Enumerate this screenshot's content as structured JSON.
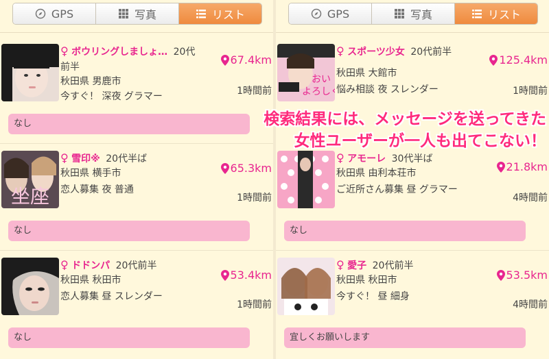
{
  "tabs": {
    "gps": "GPS",
    "photo": "写真",
    "list": "リスト"
  },
  "left": [
    {
      "name": "ボウリングしましょ…",
      "age": "20代",
      "age2": "前半",
      "pref": "秋田県",
      "city": "男鹿市",
      "tags": "今すぐ！ 深夜 グラマー",
      "distance": "67.4km",
      "time": "1時間前",
      "message": "なし"
    },
    {
      "name": "雪印※",
      "age": "20代半ば",
      "pref": "秋田県",
      "city": "横手市",
      "tags": "恋人募集 夜 普通",
      "distance": "65.3km",
      "time": "1時間前",
      "message": "なし"
    },
    {
      "name": "ドドンパ",
      "age": "20代前半",
      "pref": "秋田県",
      "city": "秋田市",
      "tags": "恋人募集 昼 スレンダー",
      "distance": "53.4km",
      "time": "1時間前",
      "message": "なし"
    }
  ],
  "right": [
    {
      "name": "スポーツ少女",
      "age": "20代前半",
      "pref": "秋田県",
      "city": "大館市",
      "tags": "悩み相談 夜 スレンダー",
      "distance": "125.4km",
      "time": "1時間前",
      "message": ""
    },
    {
      "name": "アモーレ",
      "age": "30代半ば",
      "pref": "秋田県",
      "city": "由利本荘市",
      "tags": "ご近所さん募集 昼 グラマー",
      "distance": "21.8km",
      "time": "4時間前",
      "message": "なし"
    },
    {
      "name": "愛子",
      "age": "20代前半",
      "pref": "秋田県",
      "city": "秋田市",
      "tags": "今すぐ！ 昼 細身",
      "distance": "53.5km",
      "time": "4時間前",
      "message": "宜しくお願いします"
    }
  ],
  "overlay": {
    "line1": "検索結果には、メッセージを送ってきた",
    "line2": "女性ユーザーが一人も出てこない！"
  },
  "female_symbol": "♀",
  "colors": {
    "accent": "#e8268f",
    "tab_active": "#ef8a3e",
    "message_bg": "#f9b6cf",
    "overlay": "#ff2a7c"
  }
}
